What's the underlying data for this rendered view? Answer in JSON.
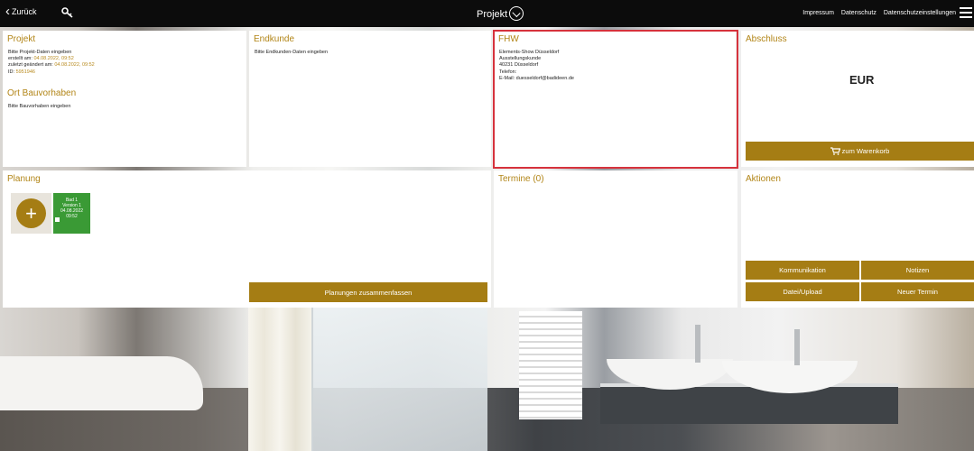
{
  "topbar": {
    "back_label": "Zurück",
    "title": "Projekt",
    "links": [
      "Impressum",
      "Datenschutz",
      "Datenschutzeinstellungen"
    ]
  },
  "projekt": {
    "title": "Projekt",
    "line1": "Bitte Projekt-Daten eingeben",
    "created_label": "erstellt am:",
    "created_value": "04.08.2022, 09:52",
    "changed_label": "zuletzt geändert am:",
    "changed_value": "04.08.2022, 09:52",
    "id_label": "ID:",
    "id_value": "5951946",
    "ort_title": "Ort Bauvorhaben",
    "ort_text": "Bitte Bauvorhaben eingeben"
  },
  "endkunde": {
    "title": "Endkunde",
    "text": "Bitte Endkunden-Daten eingeben"
  },
  "fhw": {
    "title": "FHW",
    "lines": [
      "Elements-Show Düsseldorf",
      "Ausstellungskunde",
      "40231 Düsseldorf",
      "Telefon:",
      "E-Mail: duesseldorf@badideen.de"
    ]
  },
  "abschluss": {
    "title": "Abschluss",
    "currency": "EUR",
    "cart_label": "zum Warenkorb"
  },
  "planung": {
    "title": "Planung",
    "card": {
      "line1": "Bad 1",
      "line2": "Version 1",
      "line3": "04.08.2022",
      "line4": "09:52"
    },
    "merge_label": "Planungen zusammenfassen"
  },
  "termine": {
    "title": "Termine (0)"
  },
  "aktionen": {
    "title": "Aktionen",
    "buttons": [
      "Kommunikation",
      "Notizen",
      "Datei/Upload",
      "Neuer Termin"
    ]
  },
  "colors": {
    "gold": "#a57d14",
    "title_gold": "#b28517",
    "highlight_red": "#d6323c",
    "card_green": "#3a9a35",
    "topbar": "#0c0c0c"
  }
}
